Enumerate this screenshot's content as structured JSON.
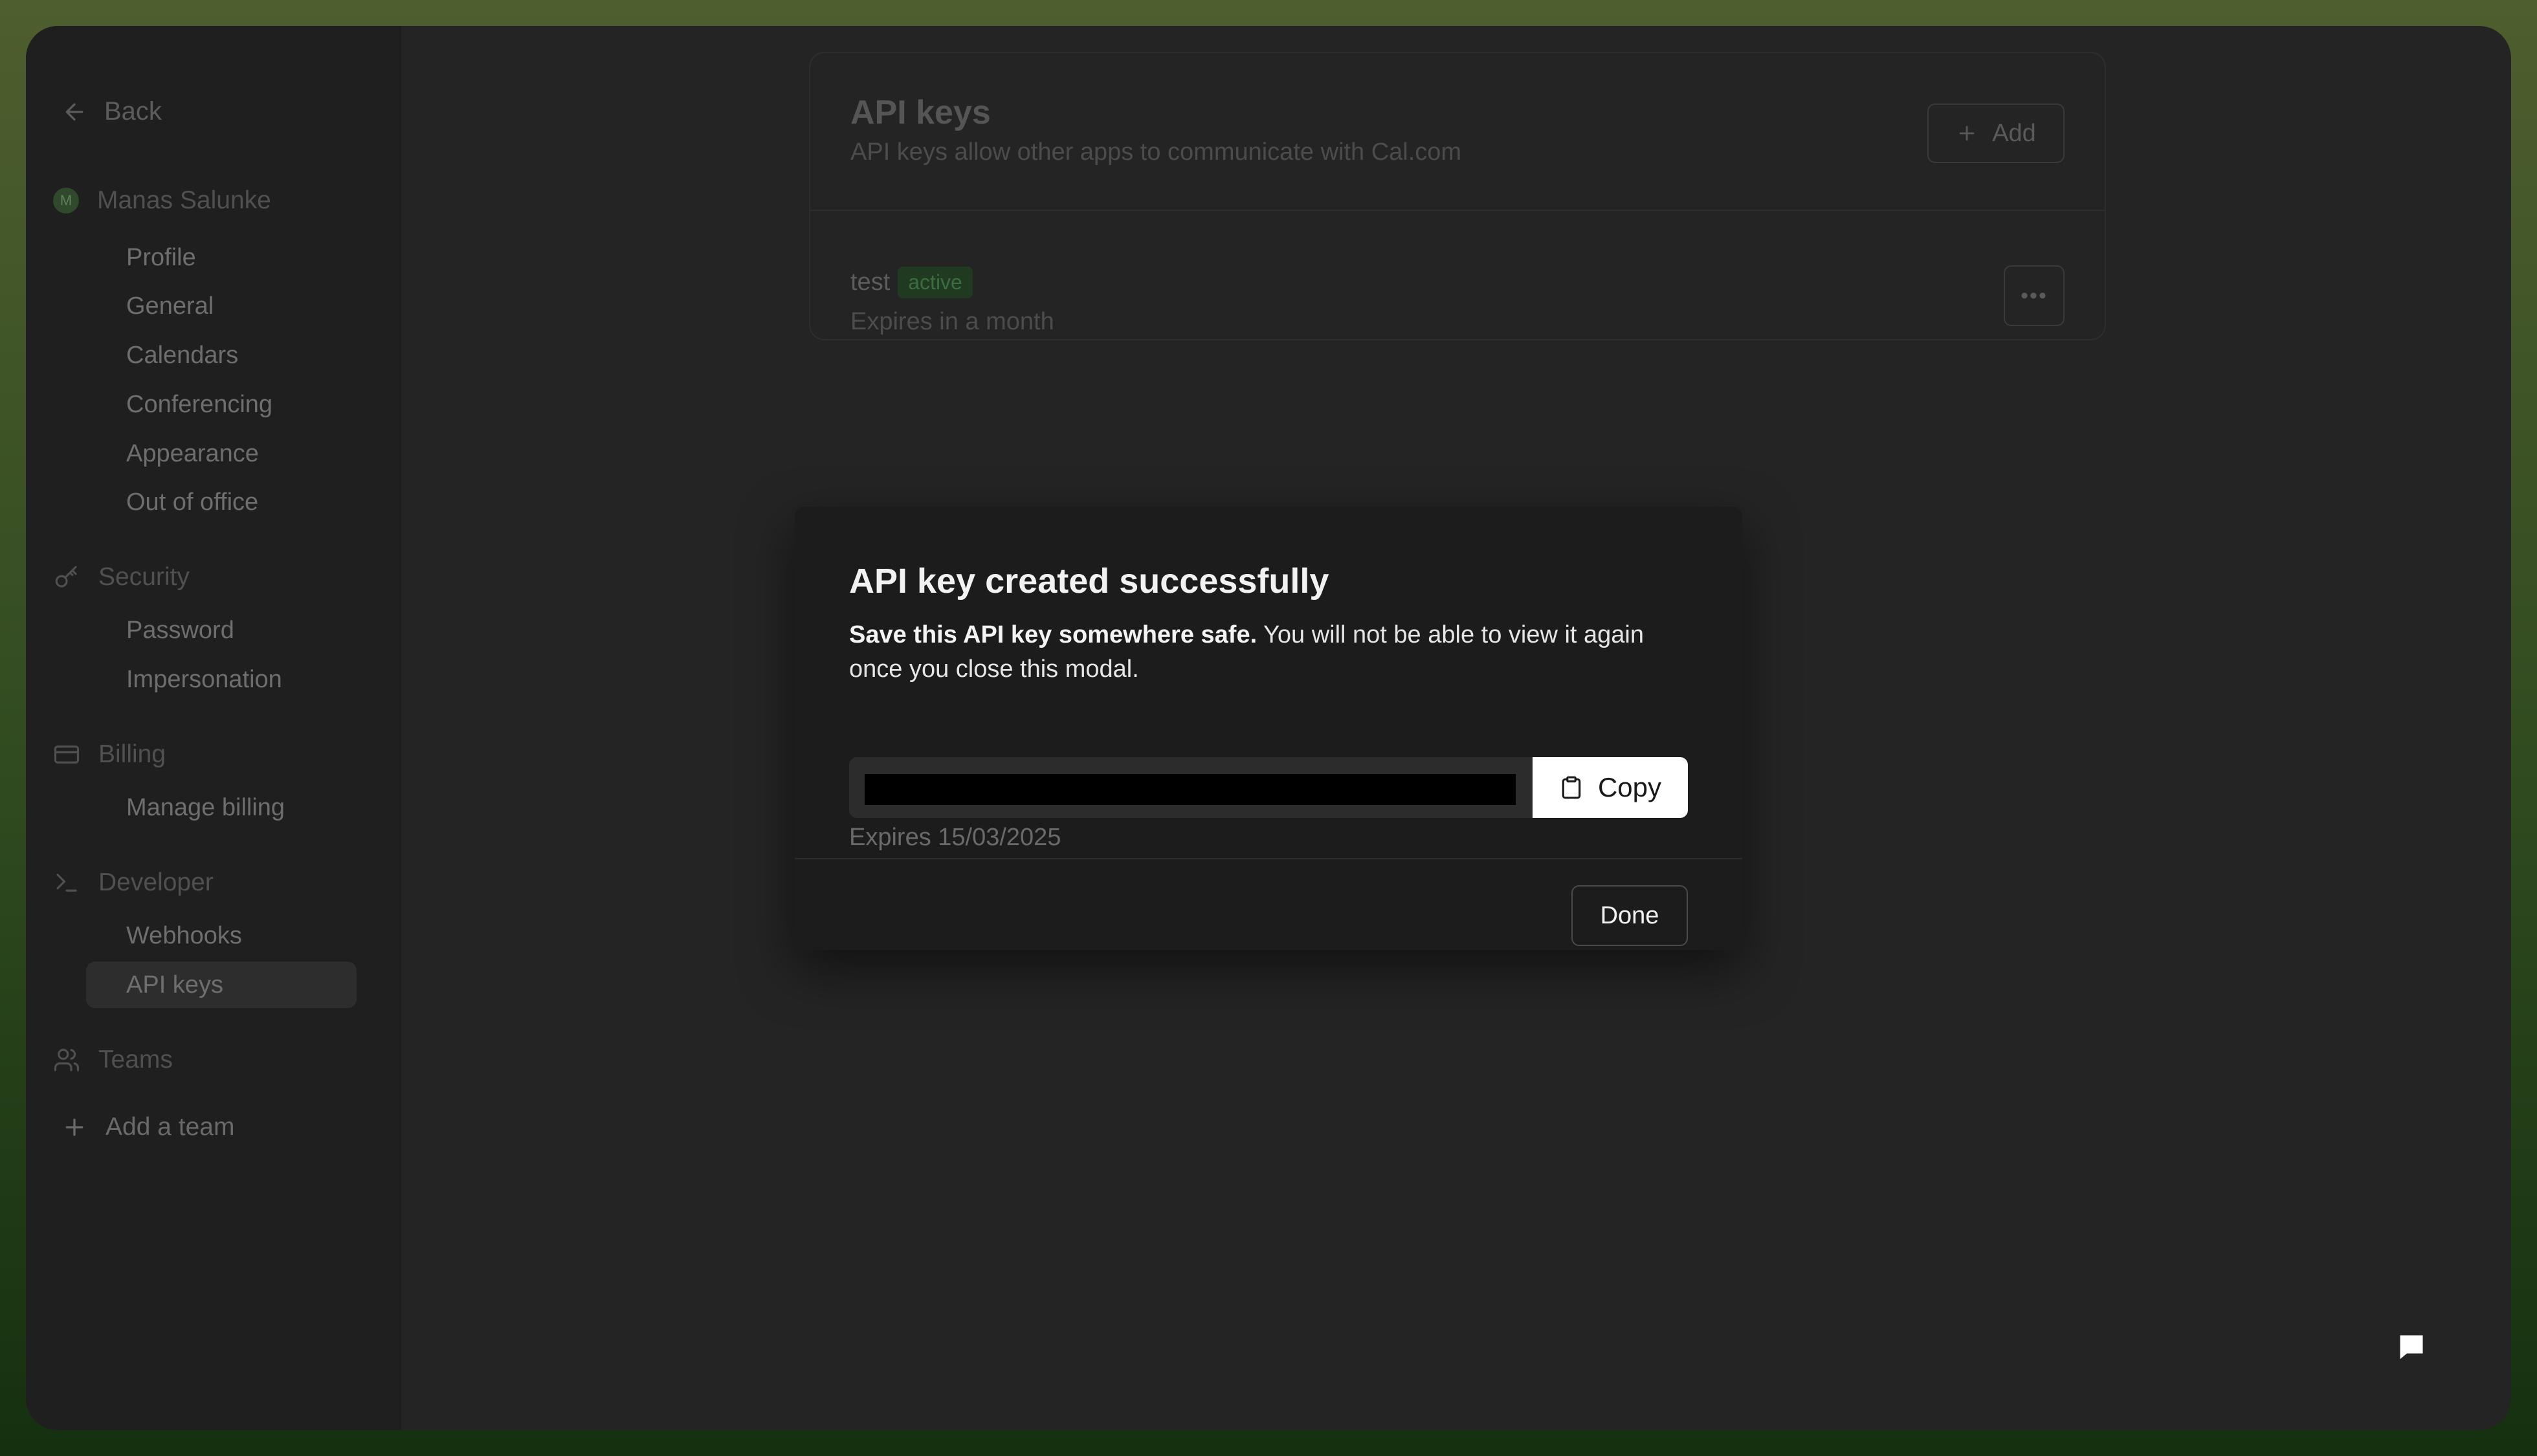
{
  "sidebar": {
    "back_label": "Back",
    "user": {
      "initial": "M",
      "name": "Manas Salunke"
    },
    "account_items": [
      "Profile",
      "General",
      "Calendars",
      "Conferencing",
      "Appearance",
      "Out of office"
    ],
    "security": {
      "label": "Security",
      "items": [
        "Password",
        "Impersonation"
      ]
    },
    "billing": {
      "label": "Billing",
      "items": [
        "Manage billing"
      ]
    },
    "developer": {
      "label": "Developer",
      "items": [
        "Webhooks",
        "API keys"
      ]
    },
    "teams": {
      "label": "Teams"
    },
    "add_team_label": "Add a team"
  },
  "main": {
    "title": "API keys",
    "subtitle": "API keys allow other apps to communicate with Cal.com",
    "add_label": "Add",
    "key": {
      "name": "test",
      "status": "active",
      "expiry": "Expires in a month"
    }
  },
  "modal": {
    "title": "API key created successfully",
    "bold_text": "Save this API key somewhere safe.",
    "text": " You will not be able to view it again once you close this modal.",
    "copy_label": "Copy",
    "expiry": "Expires 15/03/2025",
    "done_label": "Done"
  },
  "icons": {
    "back": "arrow-left-icon",
    "security": "key-icon",
    "billing": "credit-card-icon",
    "developer": "terminal-icon",
    "teams": "users-icon",
    "add": "plus-icon",
    "copy": "clipboard-icon",
    "more": "ellipsis-icon",
    "chat": "chat-icon"
  },
  "colors": {
    "background_top": "#4e5e2e",
    "background_bottom": "#14300f",
    "app_background": "#242424",
    "modal_background": "#1c1c1c",
    "badge_text": "#3d6d3f"
  }
}
